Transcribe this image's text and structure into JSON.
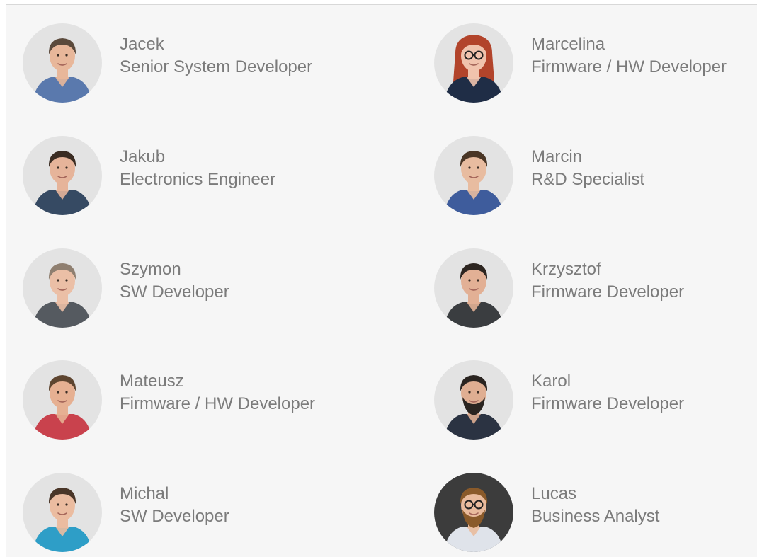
{
  "team": {
    "members": [
      {
        "name": "Jacek",
        "role": "Senior System Developer",
        "shirt": "#5a79ad",
        "hair": "#5b4a3c",
        "skin": "#e8b79a",
        "bg": "#e3e3e3",
        "glasses": false,
        "beard": false
      },
      {
        "name": "Marcelina",
        "role": "Firmware / HW Developer",
        "shirt": "#1f2d46",
        "hair": "#b2442b",
        "skin": "#f0c3ad",
        "bg": "#e3e3e3",
        "glasses": true,
        "beard": false
      },
      {
        "name": "Jakub",
        "role": "Electronics Engineer",
        "shirt": "#364a63",
        "hair": "#3a2c22",
        "skin": "#e6b49a",
        "bg": "#e3e3e3",
        "glasses": false,
        "beard": false
      },
      {
        "name": "Marcin",
        "role": "R&D Specialist",
        "shirt": "#3e5c9c",
        "hair": "#4a3626",
        "skin": "#e8bca0",
        "bg": "#e3e3e3",
        "glasses": false,
        "beard": false
      },
      {
        "name": "Szymon",
        "role": "SW Developer",
        "shirt": "#555a60",
        "hair": "#8f7f70",
        "skin": "#ebbfa6",
        "bg": "#e3e3e3",
        "glasses": false,
        "beard": false
      },
      {
        "name": "Krzysztof",
        "role": "Firmware Developer",
        "shirt": "#3a3d40",
        "hair": "#2d2520",
        "skin": "#e2b095",
        "bg": "#e3e3e3",
        "glasses": false,
        "beard": false
      },
      {
        "name": "Mateusz",
        "role": "Firmware / HW Developer",
        "shirt": "#c9424d",
        "hair": "#5e4530",
        "skin": "#e6b092",
        "bg": "#e3e3e3",
        "glasses": false,
        "beard": false
      },
      {
        "name": "Karol",
        "role": "Firmware Developer",
        "shirt": "#2b3342",
        "hair": "#2a2420",
        "skin": "#dfae92",
        "bg": "#e3e3e3",
        "glasses": false,
        "beard": true
      },
      {
        "name": "Michal",
        "role": "SW Developer",
        "shirt": "#2e9ec7",
        "hair": "#4a3628",
        "skin": "#ebbca0",
        "bg": "#e3e3e3",
        "glasses": false,
        "beard": false
      },
      {
        "name": "Lucas",
        "role": "Business Analyst",
        "shirt": "#dfe3ea",
        "hair": "#8a5a2a",
        "skin": "#e9bb9d",
        "bg": "#3c3c3c",
        "glasses": true,
        "beard": true
      }
    ]
  }
}
